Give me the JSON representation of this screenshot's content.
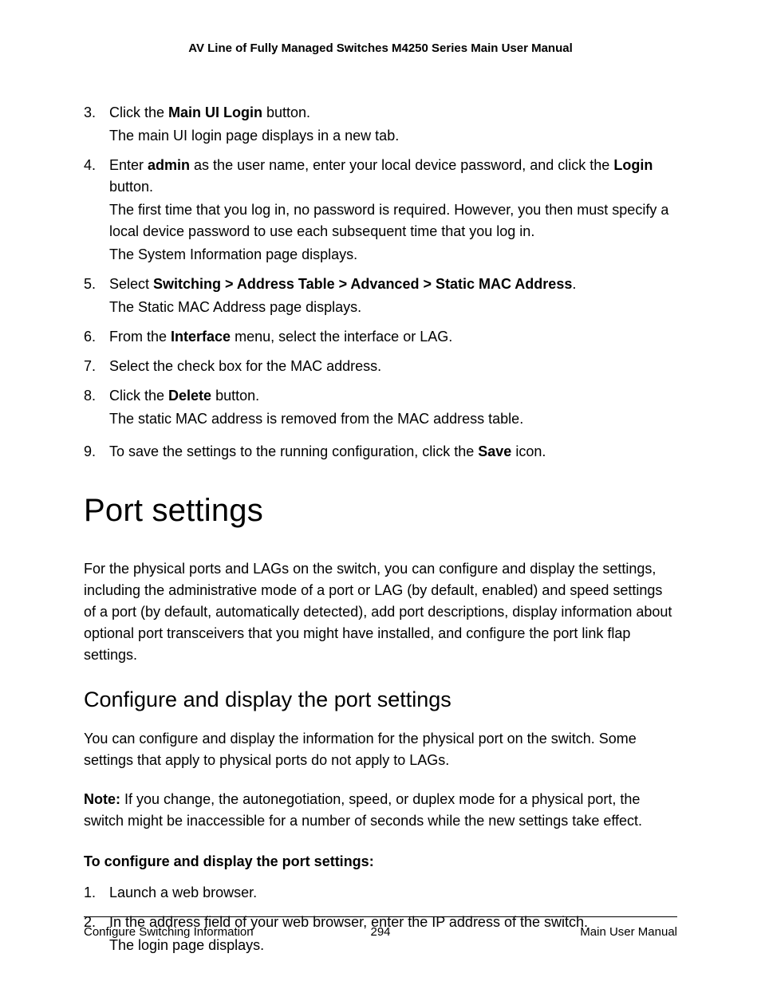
{
  "header": {
    "title": "AV Line of Fully Managed Switches M4250 Series Main User Manual"
  },
  "steps_a": {
    "s3": {
      "num": "3.",
      "t1a": "Click the ",
      "t1b": "Main UI Login",
      "t1c": " button.",
      "t2": "The main UI login page displays in a new tab."
    },
    "s4": {
      "num": "4.",
      "t1a": "Enter ",
      "t1b": "admin",
      "t1c": " as the user name, enter your local device password, and click the ",
      "t1d": "Login",
      "t1e": " button.",
      "t2": "The first time that you log in, no password is required. However, you then must specify a local device password to use each subsequent time that you log in.",
      "t3": "The System Information page displays."
    },
    "s5": {
      "num": "5.",
      "t1a": "Select ",
      "t1b": "Switching > Address Table > Advanced > Static MAC Address",
      "t1c": ".",
      "t2": "The Static MAC Address page displays."
    },
    "s6": {
      "num": "6.",
      "t1a": "From the ",
      "t1b": "Interface",
      "t1c": " menu, select the interface or LAG."
    },
    "s7": {
      "num": "7.",
      "t1": "Select the check box for the MAC address."
    },
    "s8": {
      "num": "8.",
      "t1a": "Click the ",
      "t1b": "Delete",
      "t1c": " button.",
      "t2": "The static MAC address is removed from the MAC address table."
    },
    "s9": {
      "num": "9.",
      "t1a": "To save the settings to the running configuration, click the ",
      "t1b": "Save",
      "t1c": " icon."
    }
  },
  "section": {
    "heading": "Port settings",
    "intro": "For the physical ports and LAGs on the switch, you can configure and display the settings, including the administrative mode of a port or LAG (by default, enabled) and speed settings of a port (by default, automatically detected), add port descriptions, display information about optional port transceivers that you might have installed, and configure the port link flap settings.",
    "sub_heading": "Configure and display the port settings",
    "sub_intro": "You can configure and display the information for the physical port on the switch. Some settings that apply to physical ports do not apply to LAGs.",
    "note_label": "Note:",
    "note_body": "  If you change, the autonegotiation, speed, or duplex mode for a physical port, the switch might be inaccessible for a number of seconds while the new settings take effect.",
    "proc_title": "To configure and display the port settings:"
  },
  "steps_b": {
    "s1": {
      "num": "1.",
      "t1": "Launch a web browser."
    },
    "s2": {
      "num": "2.",
      "t1": "In the address field of your web browser, enter the IP address of the switch.",
      "t2": "The login page displays."
    }
  },
  "footer": {
    "left": "Configure Switching Information",
    "center": "294",
    "right": "Main User Manual"
  }
}
